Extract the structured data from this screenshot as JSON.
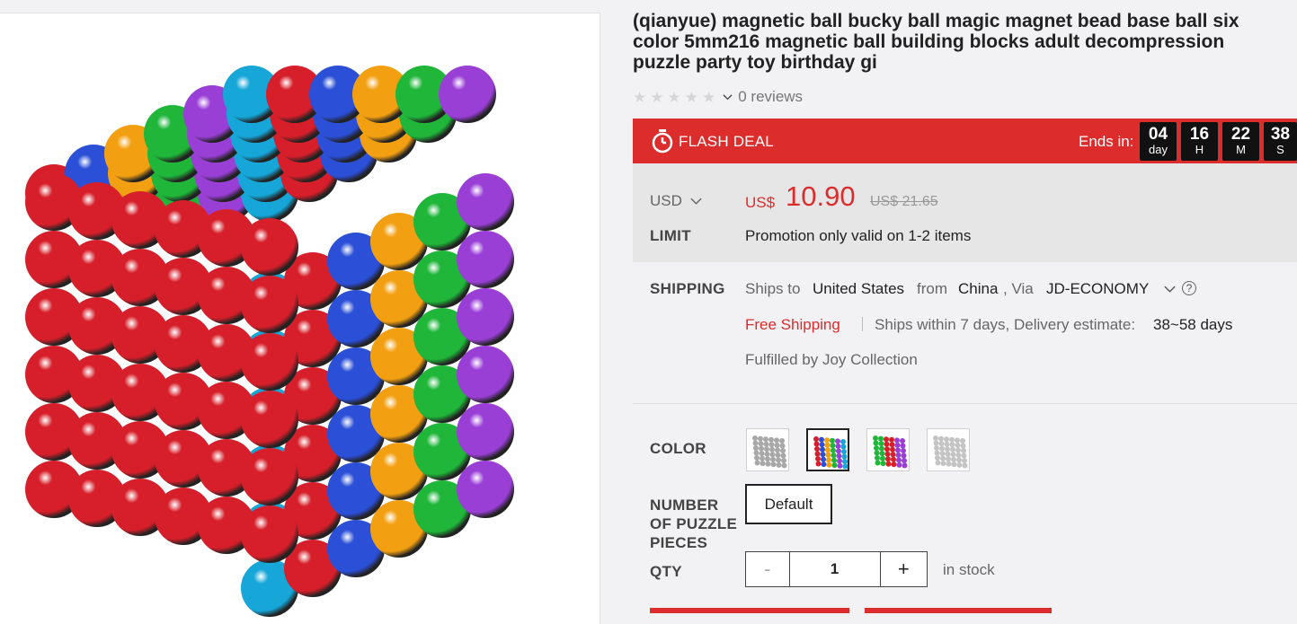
{
  "product": {
    "title": "(qianyue) magnetic ball bucky ball magic magnet bead base ball six color 5mm216 magnetic ball building blocks adult decompression puzzle party toy birthday gi",
    "image_alt": "rainbow magnetic ball cube",
    "ball_colors": [
      "#d61f2a",
      "#2b4fd6",
      "#f2a012",
      "#1fb63a",
      "#9a3fd6",
      "#16a6d8"
    ]
  },
  "rating": {
    "stars": 0,
    "max_stars": 5,
    "reviews_text": "0 reviews"
  },
  "flash_deal": {
    "label": "FLASH DEAL",
    "ends_label": "Ends in:",
    "countdown": [
      {
        "value": "04",
        "unit": "day"
      },
      {
        "value": "16",
        "unit": "H"
      },
      {
        "value": "22",
        "unit": "M"
      },
      {
        "value": "38",
        "unit": "S"
      }
    ]
  },
  "price": {
    "currency_selector": "USD",
    "currency_prefix": "US$",
    "current": "10.90",
    "original": "US$ 21.65"
  },
  "limit": {
    "label": "LIMIT",
    "text": "Promotion only valid on 1-2 items"
  },
  "shipping": {
    "label": "SHIPPING",
    "ships_to_label": "Ships to",
    "destination": "United States",
    "from_label": "from",
    "origin": "China",
    "via_label": ", Via",
    "method": "JD-ECONOMY",
    "free_label": "Free Shipping",
    "ships_within": "Ships within 7 days, Delivery estimate:",
    "estimate": "38~58 days",
    "fulfilled": "Fulfilled by Joy Collection"
  },
  "options": {
    "color_label": "COLOR",
    "pieces_label_lines": [
      "NUMBER",
      "OF PUZZLE",
      "PIECES"
    ],
    "pieces_value": "Default",
    "qty_label": "QTY",
    "qty_minus": "-",
    "qty_value": "1",
    "qty_plus": "+",
    "stock_text": "in stock"
  },
  "colors": {
    "accent": "#dd2c2c",
    "countdown_bg": "#111111",
    "price_bg": "#e7e6e7"
  }
}
